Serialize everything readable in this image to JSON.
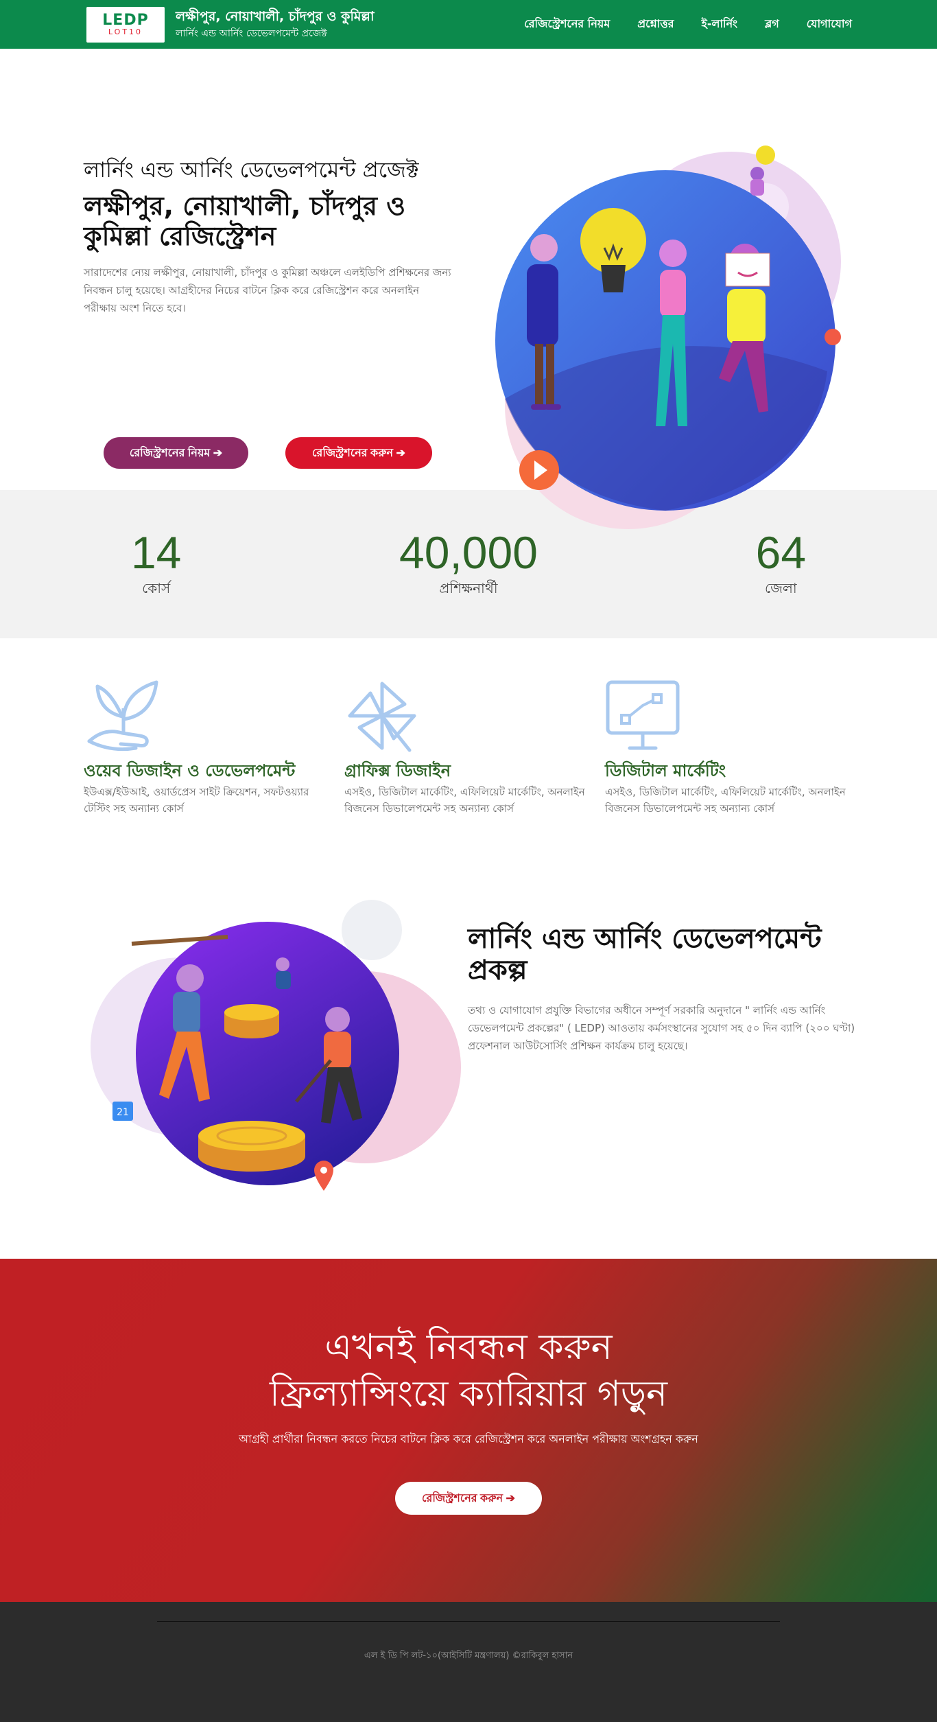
{
  "header": {
    "logo_main": "LEDP",
    "logo_sub": "LOT10",
    "brand_title": "লক্ষীপুর, নোয়াখালী, চাঁদপুর ও কুমিল্লা",
    "brand_sub": "লার্নিং এন্ড আর্নিং ডেভেলপমেন্ট প্রজেক্ট",
    "nav": [
      "রেজিস্ট্রেশনের নিয়ম",
      "প্রশ্নোত্তর",
      "ই-লার্নিং",
      "ব্লগ",
      "যোগাযোগ"
    ]
  },
  "hero": {
    "pre_title": "লার্নিং এন্ড আর্নিং ডেভেলপমেন্ট প্রজেক্ট",
    "title": "লক্ষীপুর, নোয়াখালী, চাঁদপুর ও কুমিল্লা রেজিস্ট্রেশন",
    "description": "সারাদেশের ন্যেয় লক্ষীপুর, নোয়াখালী, চাঁদপুর ও কুমিল্লা অঞ্চলে এলইডিপি প্রশিক্ষনের জন্য নিবন্ধন চালু হয়েছে। আগ্রহীদের নিচের বাটনে ক্লিক করে রেজিস্ট্রেশন করে অনলাইন পরীক্ষায় অংশ নিতে হবে।",
    "btn_rules": "রেজিস্ট্রশনের নিয়ম ➔",
    "btn_register": "রেজিস্ট্রশনের করুন ➔"
  },
  "stats": [
    {
      "value": "14",
      "label": "কোর্স"
    },
    {
      "value": "40,000",
      "label": "প্রশিক্ষনার্থী"
    },
    {
      "value": "64",
      "label": "জেলা"
    }
  ],
  "features": [
    {
      "icon": "plant-hand-icon",
      "title": "ওয়েব ডিজাইন ও ডেভেলপমেন্ট",
      "description": "ইউএক্স/ইউআই, ওয়ার্ডপ্রেস সাইট ক্রিয়েশন, সফটওয়্যার টেস্টিং সহ অন্যান্য কোর্স"
    },
    {
      "icon": "pinwheel-icon",
      "title": "গ্রাফিক্স ডিজাইন",
      "description": "এসইও, ডিজিটাল মার্কেটিং, এফিলিয়েট মার্কেটিং, অনলাইন বিজনেস ডিভালেপমেন্ট সহ অন্যান্য কোর্স"
    },
    {
      "icon": "monitor-chart-icon",
      "title": "ডিজিটাল মার্কেটিং",
      "description": "এসইও, ডিজিটাল মার্কেটিং, এফিলিয়েট মার্কেটিং, অনলাইন বিজনেস ডিভালেপমেন্ট সহ অন্যান্য কোর্স"
    }
  ],
  "about": {
    "title": "লার্নিং এন্ড আর্নিং ডেভেলপমেন্ট প্রকল্প",
    "description": "তথ্য ও যোগাযোগ প্রযুক্তি বিভাগের অধীনে সম্পূর্ণ সরকারি অনুদানে \" লার্নিং এন্ড আর্নিং ডেভেলপমেন্ট প্রকল্পের\" ( LEDP) আওতায় কর্মসংস্থানের সুযোগ সহ ৫০ দিন ব্যাপি (২০০ ঘণ্টা) প্রফেশনাল আউটসোর্সিং প্রশিক্ষন কার্যক্রম চালু হয়েছে।",
    "calendar_number": "21"
  },
  "cta": {
    "line1": "এখনই নিবন্ধন করুন",
    "line2": "ফ্রিল্যান্সিংয়ে ক্যারিয়ার গড়ুন",
    "description": "আগ্রহী প্রার্থীরা নিবন্ধন করতে নিচের বাটনে ক্লিক করে রেজিস্ট্রেশন করে অনলাইন পরীক্ষায় অংশগ্রহন করুন",
    "button": "রেজিস্ট্রশনের করুন ➔"
  },
  "footer": {
    "text": "এল ই ডি পি লট-১০(আইসিটি মন্ত্রণালয়) ©রাকিবুল হাসান"
  },
  "colors": {
    "brand_green": "#0c8a4c",
    "stat_green": "#2e6427",
    "btn_purple": "#8b2a64",
    "btn_red": "#d9142b",
    "footer_bg": "#2c2c2c"
  }
}
